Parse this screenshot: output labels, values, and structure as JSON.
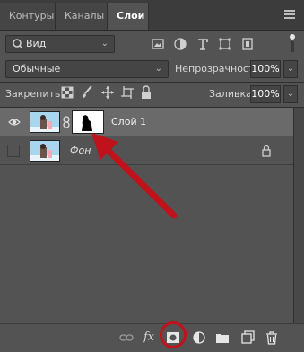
{
  "tabs": [
    {
      "label": "Контуры"
    },
    {
      "label": "Каналы"
    },
    {
      "label": "Слои"
    }
  ],
  "filter": {
    "label": "Вид"
  },
  "blend_mode": {
    "value": "Обычные"
  },
  "opacity": {
    "label": "Непрозрачность:",
    "value": "100%"
  },
  "lock": {
    "label": "Закрепить:"
  },
  "fill": {
    "label": "Заливка:",
    "value": "100%"
  },
  "layers": [
    {
      "name": "Слой 1",
      "visible": true,
      "selected": true
    },
    {
      "name": "Фон",
      "visible": false,
      "locked": true
    }
  ],
  "bottom_icons": [
    "link-icon",
    "fx-icon",
    "add-mask-icon",
    "adjustment-icon",
    "folder-icon",
    "new-layer-icon",
    "trash-icon"
  ],
  "accent": "#c0121a"
}
